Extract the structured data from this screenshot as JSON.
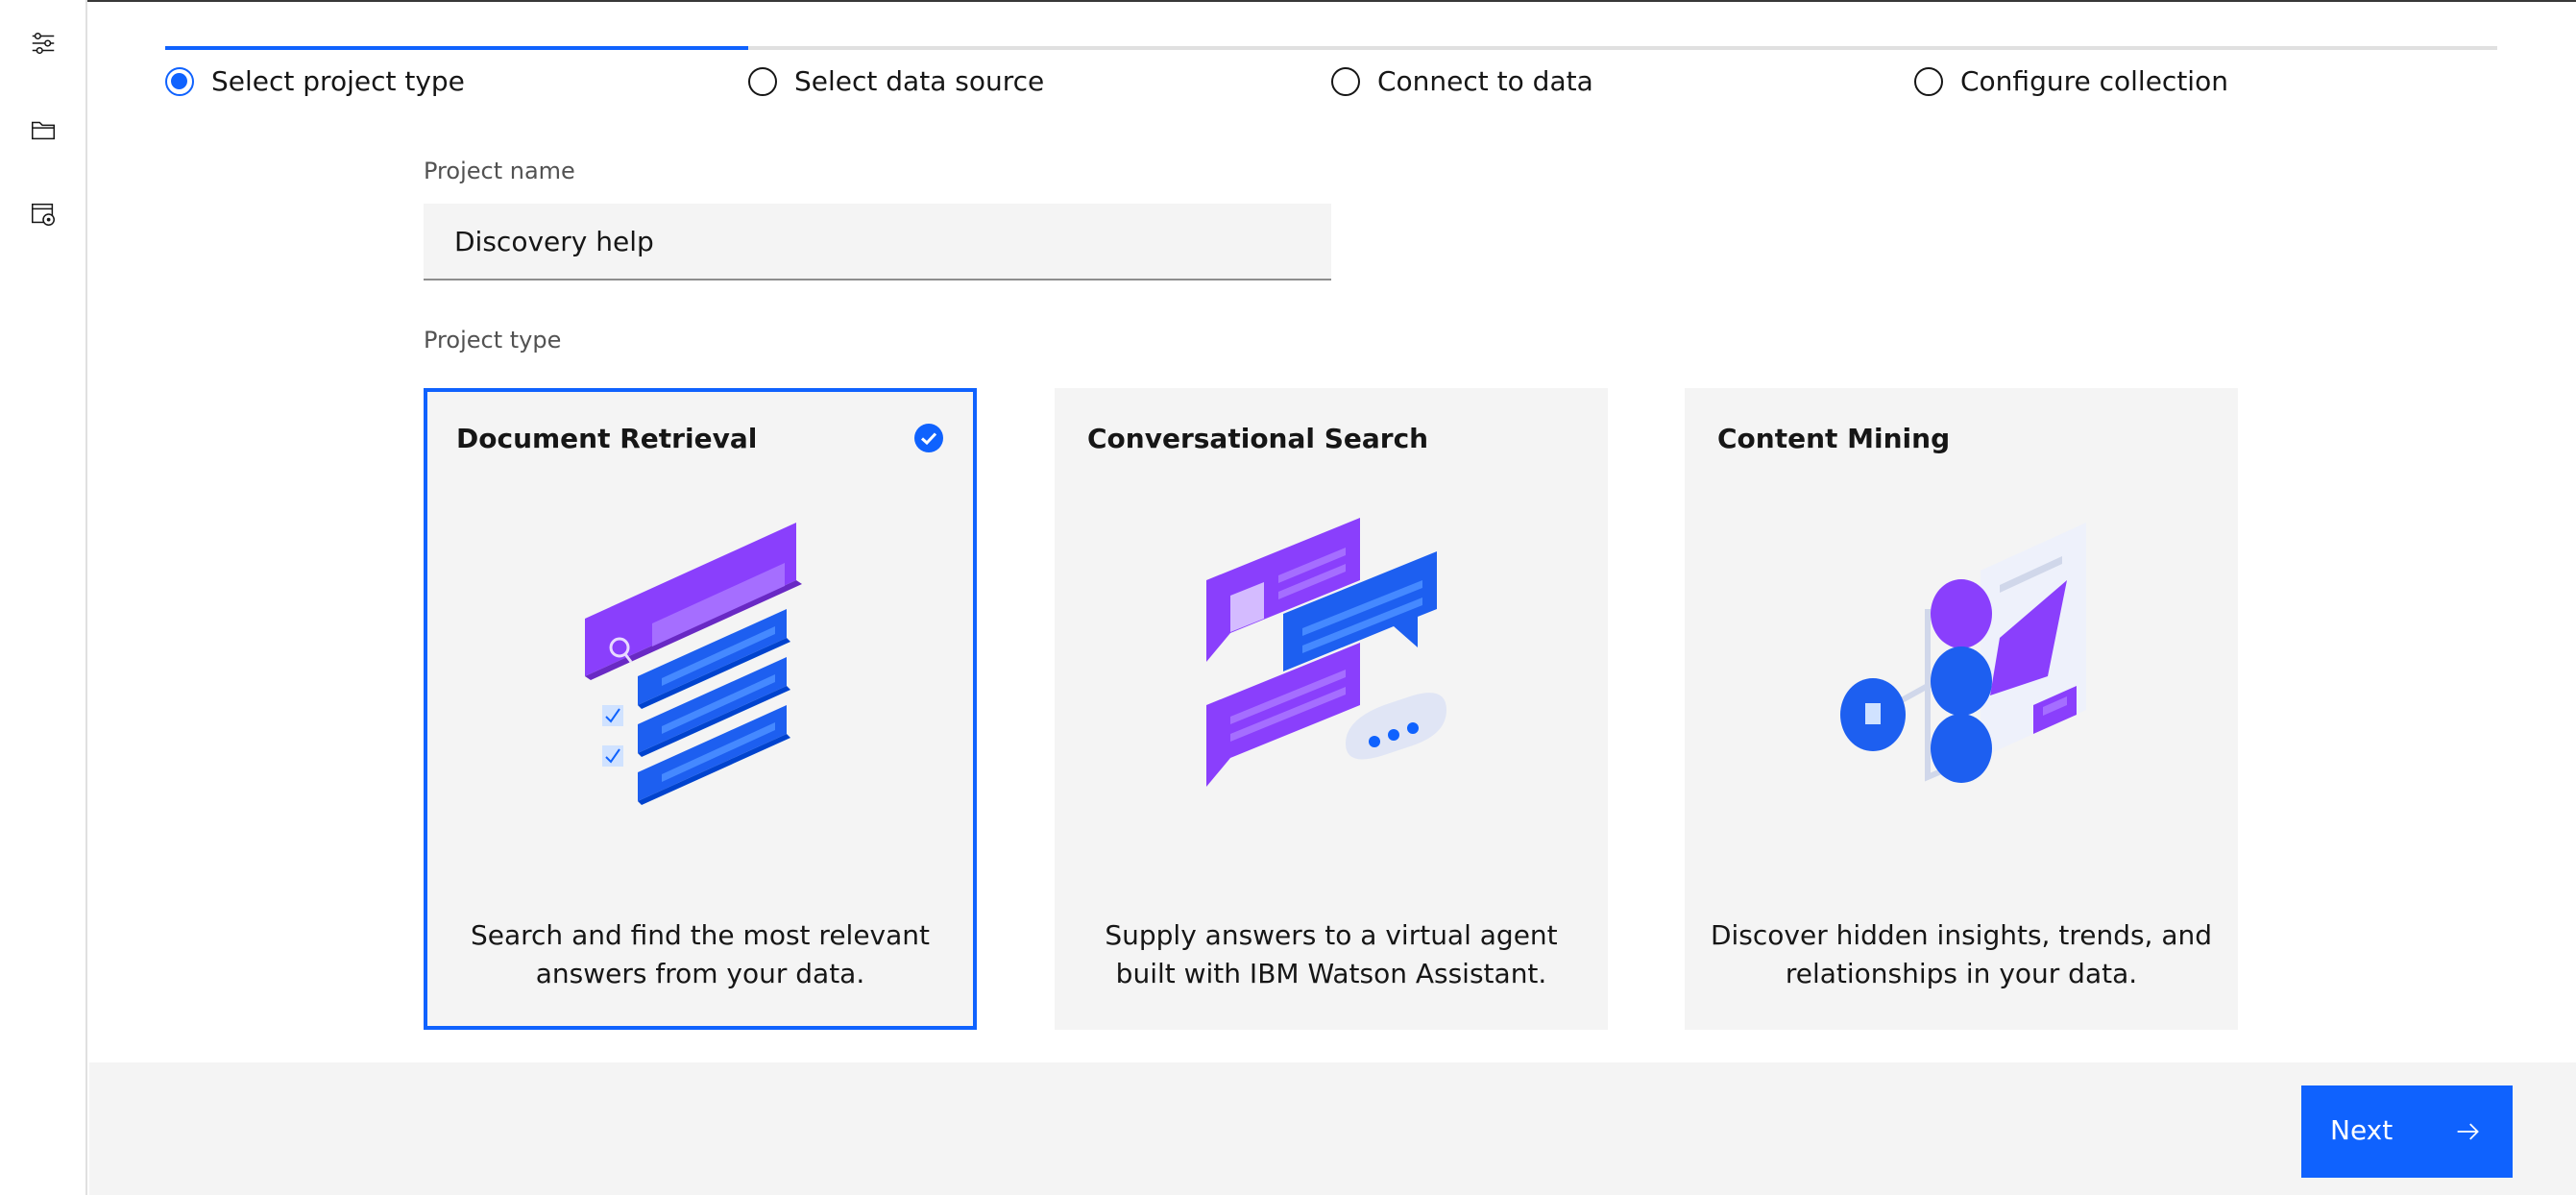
{
  "steps": [
    {
      "label": "Select project type",
      "active": true
    },
    {
      "label": "Select data source",
      "active": false
    },
    {
      "label": "Connect to data",
      "active": false
    },
    {
      "label": "Configure collection",
      "active": false
    }
  ],
  "form": {
    "project_name_label": "Project name",
    "project_name_value": "Discovery help",
    "project_type_label": "Project type"
  },
  "cards": [
    {
      "title": "Document Retrieval",
      "description": "Search and find the most relevant answers from your data.",
      "selected": true
    },
    {
      "title": "Conversational Search",
      "description": "Supply answers to a virtual agent built with IBM Watson Assistant.",
      "selected": false
    },
    {
      "title": "Content Mining",
      "description": "Discover hidden insights, trends, and relationships in your data.",
      "selected": false
    }
  ],
  "footer": {
    "next_label": "Next"
  },
  "icons": {
    "sidebar": [
      "settings-sliders-icon",
      "folder-icon",
      "data-collection-icon"
    ],
    "selected_check": "checkmark-filled-icon",
    "next_arrow": "arrow-right-icon"
  },
  "colors": {
    "accent": "#0f62fe",
    "purple": "#8a3ffc",
    "card_bg": "#f4f4f4"
  }
}
